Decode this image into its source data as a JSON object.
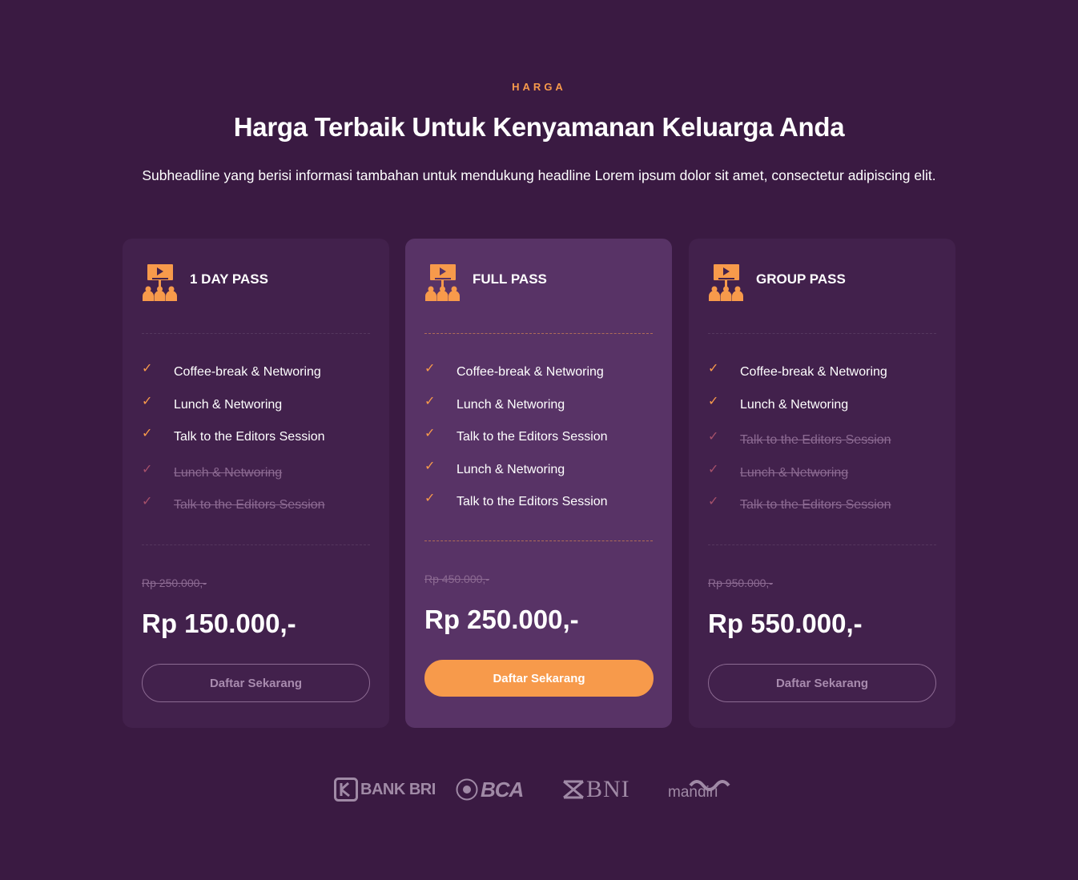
{
  "section": {
    "eyebrow": "HARGA",
    "headline": "Harga Terbaik Untuk Kenyamanan Keluarga Anda",
    "subheadline": "Subheadline yang berisi informasi tambahan untuk mendukung headline Lorem ipsum dolor sit amet, consectetur adipiscing elit."
  },
  "colors": {
    "background": "#3a1a42",
    "card": "#42214c",
    "card_featured": "#583366",
    "accent": "#f79a4b",
    "muted": "#8c6a92"
  },
  "plans": [
    {
      "icon": "conference-presentation-icon",
      "title": "1 DAY PASS",
      "features": [
        {
          "label": "Coffee-break & Networing",
          "included": true
        },
        {
          "label": "Lunch & Networing",
          "included": true
        },
        {
          "label": "Talk to the Editors Session",
          "included": true
        },
        {
          "label": "Lunch & Networing",
          "included": false
        },
        {
          "label": "Talk to the Editors Session",
          "included": false
        }
      ],
      "old_price": "Rp 250.000,-",
      "price": "Rp 150.000,-",
      "cta": "Daftar Sekarang",
      "featured": false
    },
    {
      "icon": "conference-presentation-icon",
      "title": "FULL PASS",
      "features": [
        {
          "label": "Coffee-break & Networing",
          "included": true
        },
        {
          "label": "Lunch & Networing",
          "included": true
        },
        {
          "label": "Talk to the Editors Session",
          "included": true
        },
        {
          "label": "Lunch & Networing",
          "included": true
        },
        {
          "label": "Talk to the Editors Session",
          "included": true
        }
      ],
      "old_price": "Rp 450.000,-",
      "price": "Rp 250.000,-",
      "cta": "Daftar Sekarang",
      "featured": true
    },
    {
      "icon": "conference-presentation-icon",
      "title": "GROUP PASS",
      "features": [
        {
          "label": "Coffee-break & Networing",
          "included": true
        },
        {
          "label": "Lunch & Networing",
          "included": true
        },
        {
          "label": "Talk to the Editors Session",
          "included": false
        },
        {
          "label": "Lunch & Networing",
          "included": false
        },
        {
          "label": "Talk to the Editors Session",
          "included": false
        }
      ],
      "old_price": "Rp 950.000,-",
      "price": "Rp 550.000,-",
      "cta": "Daftar Sekarang",
      "featured": false
    }
  ],
  "banks": {
    "bri": "BANK BRI",
    "bca": "BCA",
    "bni": "BNI",
    "mandiri": "mandiri"
  }
}
